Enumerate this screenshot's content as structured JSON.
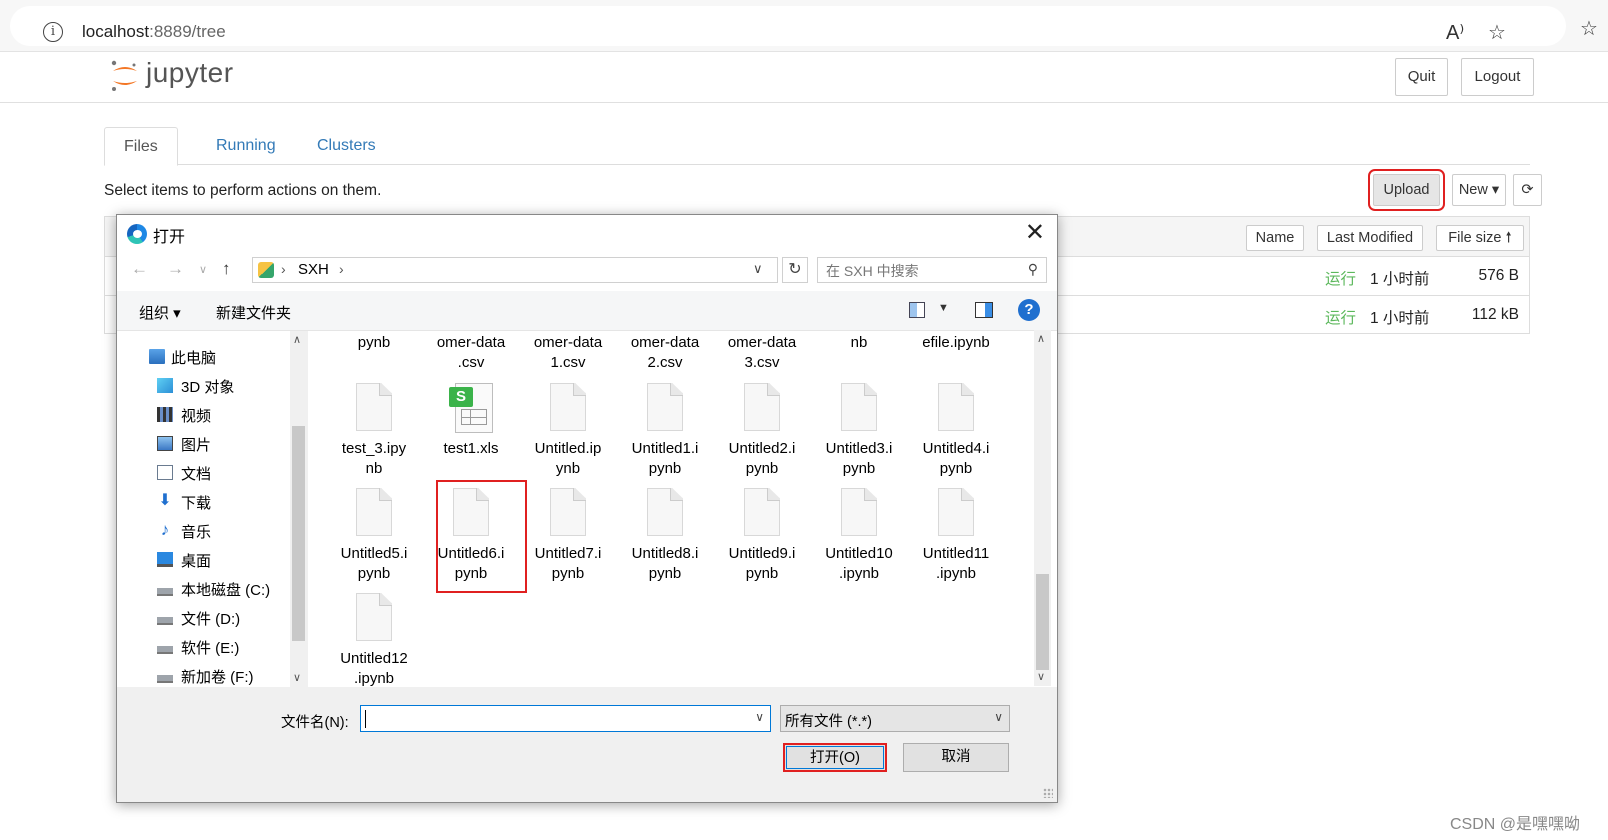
{
  "browser": {
    "url_host": "localhost",
    "url_rest": ":8889/tree"
  },
  "jupyter": {
    "logo_text": "jupyter",
    "quit_label": "Quit",
    "logout_label": "Logout",
    "tabs": [
      "Files",
      "Running",
      "Clusters"
    ],
    "instruction": "Select items to perform actions on them.",
    "upload_label": "Upload",
    "new_label": "New ▾",
    "sort_buttons": [
      "Name",
      "Last Modified",
      "File size 🠕"
    ],
    "rows": [
      {
        "status": "运行",
        "time": "1 小时前",
        "size": "576 B"
      },
      {
        "status": "运行",
        "time": "1 小时前",
        "size": "112 kB"
      }
    ]
  },
  "dialog": {
    "title": "打开",
    "path": "SXH",
    "search_placeholder": "在 SXH 中搜索",
    "organize": "组织 ▾",
    "new_folder": "新建文件夹",
    "nav_items": [
      {
        "label": "此电脑",
        "icon": "pc-icon"
      },
      {
        "label": "3D 对象",
        "icon": "cube-icon"
      },
      {
        "label": "视频",
        "icon": "video-icon"
      },
      {
        "label": "图片",
        "icon": "picture-icon"
      },
      {
        "label": "文档",
        "icon": "document-icon"
      },
      {
        "label": "下载",
        "icon": "download-icon"
      },
      {
        "label": "音乐",
        "icon": "music-icon"
      },
      {
        "label": "桌面",
        "icon": "desktop-icon"
      },
      {
        "label": "本地磁盘 (C:)",
        "icon": "drive-icon"
      },
      {
        "label": "文件 (D:)",
        "icon": "drive-icon"
      },
      {
        "label": "软件 (E:)",
        "icon": "drive-icon"
      },
      {
        "label": "新加卷 (F:)",
        "icon": "drive-icon"
      }
    ],
    "files_top_partial": [
      "pynb",
      "omer-data\n.csv",
      "omer-data\n1.csv",
      "omer-data\n2.csv",
      "omer-data\n3.csv",
      "nb",
      "efile.ipynb"
    ],
    "files": [
      {
        "name": "test_3.ipy\nnb",
        "type": "file"
      },
      {
        "name": "test1.xls",
        "type": "xls"
      },
      {
        "name": "Untitled.ip\nynb",
        "type": "file"
      },
      {
        "name": "Untitled1.i\npynb",
        "type": "file"
      },
      {
        "name": "Untitled2.i\npynb",
        "type": "file"
      },
      {
        "name": "Untitled3.i\npynb",
        "type": "file"
      },
      {
        "name": "Untitled4.i\npynb",
        "type": "file"
      },
      {
        "name": "Untitled5.i\npynb",
        "type": "file"
      },
      {
        "name": "Untitled6.i\npynb",
        "type": "file"
      },
      {
        "name": "Untitled7.i\npynb",
        "type": "file"
      },
      {
        "name": "Untitled8.i\npynb",
        "type": "file"
      },
      {
        "name": "Untitled9.i\npynb",
        "type": "file"
      },
      {
        "name": "Untitled10\n.ipynb",
        "type": "file"
      },
      {
        "name": "Untitled11\n.ipynb",
        "type": "file"
      },
      {
        "name": "Untitled12\n.ipynb",
        "type": "file"
      }
    ],
    "filename_label": "文件名(N):",
    "filename_value": "",
    "filetype": "所有文件 (*.*)",
    "open_label": "打开(O)",
    "cancel_label": "取消"
  },
  "watermark": "CSDN @是嘿嘿呦"
}
